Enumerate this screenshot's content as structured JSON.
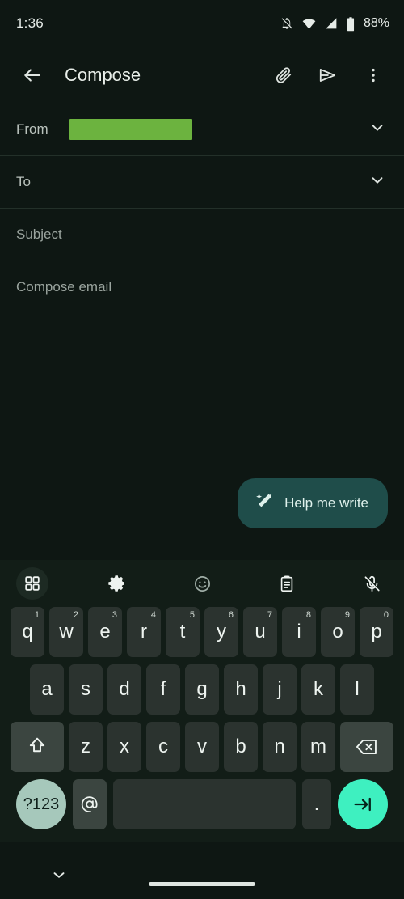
{
  "status_bar": {
    "time": "1:36",
    "battery_percent": "88%",
    "icons": [
      "bell-off-icon",
      "wifi-icon",
      "signal-icon",
      "battery-icon"
    ]
  },
  "app_bar": {
    "back_label": "back-arrow",
    "title": "Compose",
    "actions": [
      {
        "name": "attach-icon",
        "label": "Attach"
      },
      {
        "name": "send-icon",
        "label": "Send"
      },
      {
        "name": "overflow-menu-icon",
        "label": "More options"
      }
    ]
  },
  "compose": {
    "from": {
      "label": "From",
      "value": "",
      "redacted": true,
      "redaction_color": "#6cb33f"
    },
    "to": {
      "label": "To",
      "value": ""
    },
    "subject": {
      "placeholder": "Subject",
      "value": ""
    },
    "body": {
      "placeholder": "Compose email",
      "value": ""
    },
    "help_me_write": {
      "label": "Help me write",
      "icon": "magic-pen-icon",
      "color": "#1f4d4a"
    }
  },
  "keyboard": {
    "toolbar": [
      {
        "name": "grid-icon",
        "label": "Toolbar"
      },
      {
        "name": "gear-icon",
        "label": "Settings"
      },
      {
        "name": "emoji-icon",
        "label": "Emoji"
      },
      {
        "name": "clipboard-icon",
        "label": "Clipboard"
      },
      {
        "name": "mic-off-icon",
        "label": "Voice input off"
      }
    ],
    "row1": [
      {
        "key": "q",
        "num": "1"
      },
      {
        "key": "w",
        "num": "2"
      },
      {
        "key": "e",
        "num": "3"
      },
      {
        "key": "r",
        "num": "4"
      },
      {
        "key": "t",
        "num": "5"
      },
      {
        "key": "y",
        "num": "6"
      },
      {
        "key": "u",
        "num": "7"
      },
      {
        "key": "i",
        "num": "8"
      },
      {
        "key": "o",
        "num": "9"
      },
      {
        "key": "p",
        "num": "0"
      }
    ],
    "row2": [
      "a",
      "s",
      "d",
      "f",
      "g",
      "h",
      "j",
      "k",
      "l"
    ],
    "row3": [
      "z",
      "x",
      "c",
      "v",
      "b",
      "n",
      "m"
    ],
    "shift_label": "shift-icon",
    "backspace_label": "backspace-icon",
    "symbols_key": "?123",
    "at_key": "@",
    "space_key": "",
    "period_key": ".",
    "enter_label": "tab-arrow-icon",
    "enter_color": "#3ef0c0"
  },
  "nav_bar": {
    "hide_keyboard": "chevron-down-icon",
    "home_indicator": "home-pill"
  }
}
